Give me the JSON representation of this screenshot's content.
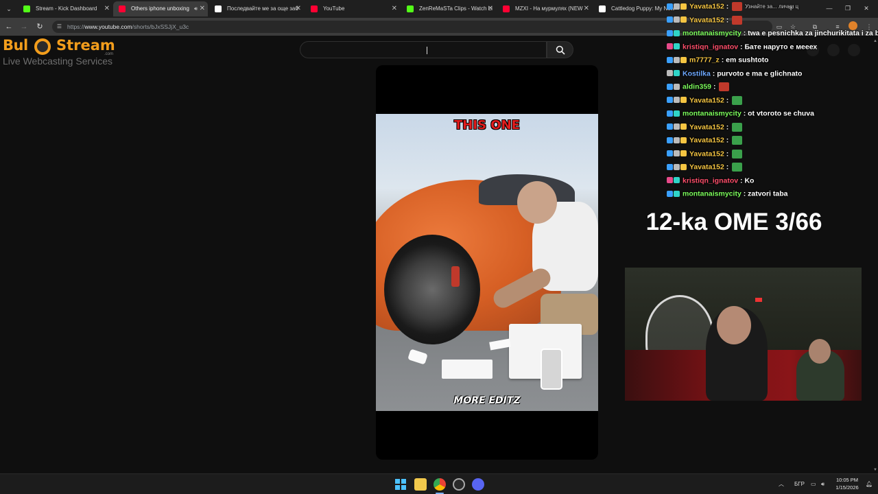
{
  "browser": {
    "tabs": [
      {
        "title": "Stream - Kick Dashboard",
        "color": "#53fc18",
        "active": false
      },
      {
        "title": "Others iphone unboxing",
        "color": "#ff0033",
        "active": true,
        "audio": true
      },
      {
        "title": "Последвайте ме за още заб",
        "color": "#ffffff",
        "active": false
      },
      {
        "title": "YouTube",
        "color": "#ff0033",
        "active": false
      },
      {
        "title": "ZenReMaSTa Clips - Watch Li",
        "color": "#53fc18",
        "active": false
      },
      {
        "title": "MZXI - На мурмулях (NEW",
        "color": "#ff0033",
        "active": false
      },
      {
        "title": "Cattledog Puppy: My New",
        "color": "#ffffff",
        "active": false
      }
    ],
    "url_scheme": "https://",
    "url_host": "www.youtube.com",
    "url_path": "/shorts/bJxSSJjX_u3c"
  },
  "overlay_logo": {
    "brand_left": "Bul",
    "brand_right": "Stream",
    "brand_com": ".com",
    "tagline": "Live Webcasting Services"
  },
  "youtube": {
    "search_placeholder": "",
    "video_caption_top": "THIS ONE",
    "video_caption_bottom": "MORE EDITZ"
  },
  "chat": [
    {
      "user": "Yavata152",
      "color": "#f5c542",
      "message": "",
      "emote": "#c0392b",
      "badges": [
        "#3aa0ff",
        "#bbbbbb",
        "#f5c542"
      ],
      "overlap_text": "Узнайте за... лични ц"
    },
    {
      "user": "Yavata152",
      "color": "#f5c542",
      "message": "",
      "emote": "#c0392b",
      "badges": [
        "#3aa0ff",
        "#bbbbbb",
        "#f5c542"
      ]
    },
    {
      "user": "montanaismycity",
      "color": "#7cfc5c",
      "message": "twa e pesnichka za jinchurikitata i za bid",
      "emote": "",
      "badges": [
        "#3aa0ff",
        "#2fd4c8"
      ]
    },
    {
      "user": "kristiqn_ignatov",
      "color": "#ff4f6b",
      "message": "Бате наруто е мееех",
      "emote": "",
      "badges": [
        "#e84a8a",
        "#2fd4c8"
      ]
    },
    {
      "user": "m7777_z",
      "color": "#f5c542",
      "message": "em sushtoto",
      "emote": "",
      "badges": [
        "#3aa0ff",
        "#bbbbbb",
        "#f5c542"
      ]
    },
    {
      "user": "Kostilka",
      "color": "#6ea8ff",
      "message": "purvoto e ma e glichnato",
      "emote": "",
      "badges": [
        "#bbbbbb",
        "#2fd4c8"
      ]
    },
    {
      "user": "aldin359",
      "color": "#7cfc5c",
      "message": "",
      "emote": "#c0392b",
      "badges": [
        "#3aa0ff",
        "#bbbbbb"
      ]
    },
    {
      "user": "Yavata152",
      "color": "#f5c542",
      "message": "",
      "emote": "#3aa04b",
      "badges": [
        "#3aa0ff",
        "#bbbbbb",
        "#f5c542"
      ]
    },
    {
      "user": "montanaismycity",
      "color": "#7cfc5c",
      "message": "ot vtoroto se chuva",
      "emote": "",
      "badges": [
        "#3aa0ff",
        "#2fd4c8"
      ]
    },
    {
      "user": "Yavata152",
      "color": "#f5c542",
      "message": "",
      "emote": "#3aa04b",
      "badges": [
        "#3aa0ff",
        "#bbbbbb",
        "#f5c542"
      ]
    },
    {
      "user": "Yavata152",
      "color": "#f5c542",
      "message": "",
      "emote": "#3aa04b",
      "badges": [
        "#3aa0ff",
        "#bbbbbb",
        "#f5c542"
      ]
    },
    {
      "user": "Yavata152",
      "color": "#f5c542",
      "message": "",
      "emote": "#3aa04b",
      "badges": [
        "#3aa0ff",
        "#bbbbbb",
        "#f5c542"
      ]
    },
    {
      "user": "Yavata152",
      "color": "#f5c542",
      "message": "",
      "emote": "#3aa04b",
      "badges": [
        "#3aa0ff",
        "#bbbbbb",
        "#f5c542"
      ]
    },
    {
      "user": "kristiqn_ignatov",
      "color": "#ff4f6b",
      "message": "Ko",
      "emote": "",
      "badges": [
        "#e84a8a",
        "#2fd4c8"
      ]
    },
    {
      "user": "montanaismycity",
      "color": "#7cfc5c",
      "message": "zatvori taba",
      "emote": "",
      "badges": [
        "#3aa0ff",
        "#2fd4c8"
      ]
    }
  ],
  "overlay_title": "12-ka OME 3/66",
  "taskbar": {
    "language": "БГР",
    "time": "10:05 PM",
    "date": "1/15/2026"
  }
}
